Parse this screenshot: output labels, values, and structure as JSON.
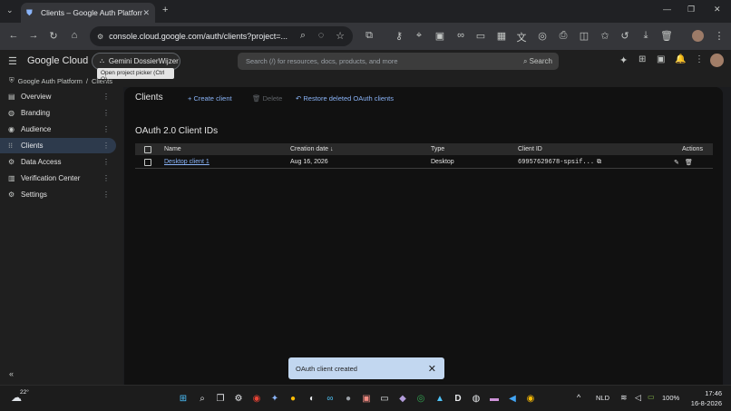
{
  "browser": {
    "tab_title": "Clients – Google Auth Platform",
    "url": "console.cloud.google.com/auth/clients?project=..."
  },
  "header": {
    "logo": "Google Cloud",
    "project_name": "Gemini DossierWijzer",
    "project_tooltip": "Open project picker (Ctrl O)",
    "search_placeholder": "Search (/) for resources, docs, products, and more",
    "search_button": "Search"
  },
  "breadcrumb": {
    "root": "Google Auth Platform",
    "sep": "/",
    "current": "Clients"
  },
  "sidebar": {
    "items": [
      {
        "label": "Overview",
        "icon": "overview-icon"
      },
      {
        "label": "Branding",
        "icon": "palette-icon"
      },
      {
        "label": "Audience",
        "icon": "audience-icon"
      },
      {
        "label": "Clients",
        "icon": "grid-icon",
        "active": true
      },
      {
        "label": "Data Access",
        "icon": "data-icon"
      },
      {
        "label": "Verification Center",
        "icon": "verification-icon"
      },
      {
        "label": "Settings",
        "icon": "gear-icon"
      }
    ]
  },
  "main": {
    "title": "Clients",
    "create_label": "Create client",
    "delete_label": "Delete",
    "restore_label": "Restore deleted OAuth clients",
    "section_title": "OAuth 2.0 Client IDs",
    "columns": [
      "Name",
      "Creation date",
      "Type",
      "Client ID",
      "Actions"
    ],
    "rows": [
      {
        "name": "Desktop client 1",
        "date": "Aug 16, 2026",
        "type": "Desktop",
        "client_id": "69957629678-spsif..."
      }
    ]
  },
  "snackbar": {
    "message": "OAuth client created"
  },
  "taskbar": {
    "temperature": "22°",
    "language": "NLD",
    "battery": "100%",
    "time": "17:46",
    "date": "16-8-2026"
  }
}
